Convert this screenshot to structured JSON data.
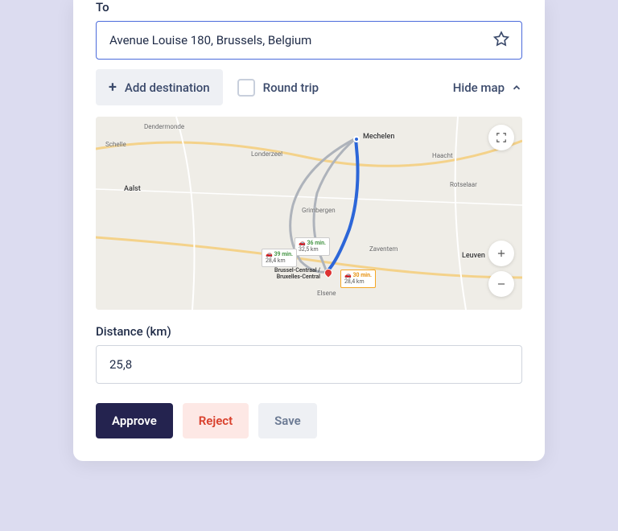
{
  "to": {
    "label": "To",
    "value": "Avenue Louise 180, Brussels, Belgium"
  },
  "controls": {
    "add_destination": "Add destination",
    "round_trip": "Round trip",
    "hide_map": "Hide map"
  },
  "map": {
    "start_city": "Mechelen",
    "end_station_line1": "Brussel-Centraal /",
    "end_station_line2": "Bruxelles-Central",
    "routes": [
      {
        "time": "30 min.",
        "dist": "28,4 km",
        "primary": true
      },
      {
        "time": "36 min.",
        "dist": "32,5 km",
        "primary": false
      },
      {
        "time": "39 min.",
        "dist": "28,4 km",
        "primary": false
      }
    ],
    "places": {
      "dendermonde": "Dendermonde",
      "aalst": "Aalst",
      "londerzeel": "Londerzeel",
      "grimbergen": "Grimbergen",
      "zaventem": "Zaventem",
      "elsene": "Elsene",
      "rotselaar": "Rotselaar",
      "leuven": "Leuven",
      "haacht": "Haacht",
      "schelle": "Schelle"
    }
  },
  "distance": {
    "label": "Distance (km)",
    "value": "25,8"
  },
  "buttons": {
    "approve": "Approve",
    "reject": "Reject",
    "save": "Save"
  }
}
